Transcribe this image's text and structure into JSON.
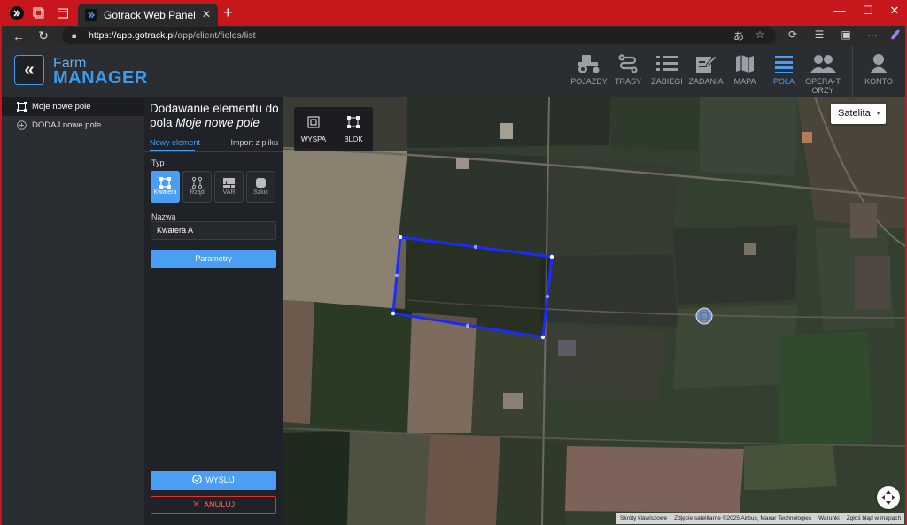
{
  "browser": {
    "tab_title": "Gotrack Web Panel",
    "url_host": "https://app.gotrack.pl",
    "url_path": "/app/client/fields/list"
  },
  "app": {
    "logo_farm": "Farm",
    "logo_manager": "MANAGER",
    "nav": [
      {
        "label": "POJAZDY",
        "icon": "tractor-icon"
      },
      {
        "label": "TRASY",
        "icon": "route-icon"
      },
      {
        "label": "ZABIEGI",
        "icon": "list-icon"
      },
      {
        "label": "ZADANIA",
        "icon": "task-edit-icon"
      },
      {
        "label": "MAPA",
        "icon": "map-icon"
      },
      {
        "label": "POLA",
        "icon": "fields-icon",
        "active": true
      },
      {
        "label": "OPERA-TORZY",
        "icon": "operators-icon"
      },
      {
        "label": "KONTO",
        "icon": "user-icon"
      }
    ]
  },
  "sidebar": {
    "items": [
      {
        "label": "Moje nowe pole",
        "icon": "polygon-icon"
      },
      {
        "label": "DODAJ nowe pole",
        "icon": "plus-circle-icon"
      }
    ]
  },
  "panel": {
    "title_prefix": "Dodawanie elementu do pola",
    "title_field": "Moje nowe pole",
    "tabs": {
      "new": "Nowy element",
      "import": "Import z pliku"
    },
    "type_label": "Typ",
    "types": [
      "Kwatera",
      "Rząd",
      "VAR",
      "Szkic"
    ],
    "name_label": "Nazwa",
    "name_value": "Kwatera A",
    "params_button": "Parametry",
    "send_button": "WYŚLIJ",
    "cancel_button": "ANULUJ"
  },
  "map": {
    "tools": [
      "WYSPA",
      "BLOK"
    ],
    "map_type": "Satelita",
    "attribution": [
      "Skróty klawiszowe",
      "Zdjęcie satelitarne ©2025 Airbus, Maxar Technologies",
      "Warunki",
      "Zgłoś błąd w mapach"
    ],
    "polygon_color": "#1a2bff"
  }
}
